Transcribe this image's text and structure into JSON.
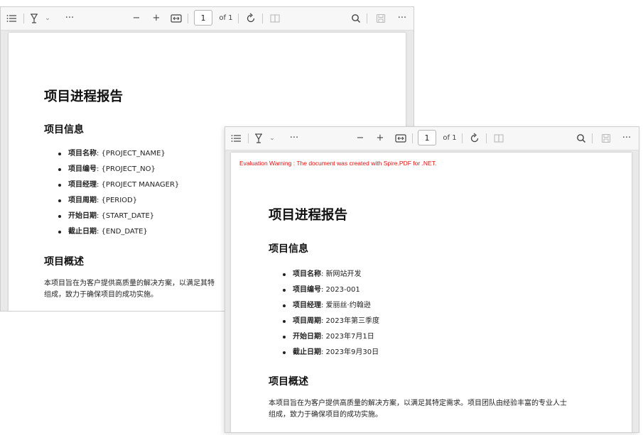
{
  "toolbar": {
    "page_number": "1",
    "page_total": "of 1",
    "zoom_out": "−",
    "zoom_in": "+",
    "more": "···"
  },
  "template_doc": {
    "title": "项目进程报告",
    "section_info": "项目信息",
    "items": [
      {
        "label": "项目名称",
        "value": ": {PROJECT_NAME}"
      },
      {
        "label": "项目编号",
        "value": ": {PROJECT_NO}"
      },
      {
        "label": "项目经理",
        "value": ": {PROJECT MANAGER}"
      },
      {
        "label": "项目周期",
        "value": ": {PERIOD}"
      },
      {
        "label": "开始日期",
        "value": ": {START_DATE}"
      },
      {
        "label": "截止日期",
        "value": ": {END_DATE}"
      }
    ],
    "section_overview": "项目概述",
    "overview_line1": "本项目旨在为客户提供高质量的解决方案，以满足其特",
    "overview_line2": "组成，致力于确保项目的成功实施。"
  },
  "filled_doc": {
    "warning": "Evaluation Warning : The document was created with Spire.PDF for .NET.",
    "title": "项目进程报告",
    "section_info": "项目信息",
    "items": [
      {
        "label": "项目名称",
        "value": ": 新网站开发"
      },
      {
        "label": "项目编号",
        "value": ": 2023-001"
      },
      {
        "label": "项目经理",
        "value": ": 爱丽丝·约翰逊"
      },
      {
        "label": "项目周期",
        "value": ": 2023年第三季度"
      },
      {
        "label": "开始日期",
        "value": ": 2023年7月1日"
      },
      {
        "label": "截止日期",
        "value": ": 2023年9月30日"
      }
    ],
    "section_overview": "项目概述",
    "overview_line1": "本项目旨在为客户提供高质量的解决方案，以满足其特定需求。项目团队由经验丰富的专业人士",
    "overview_line2": "组成，致力于确保项目的成功实施。"
  }
}
